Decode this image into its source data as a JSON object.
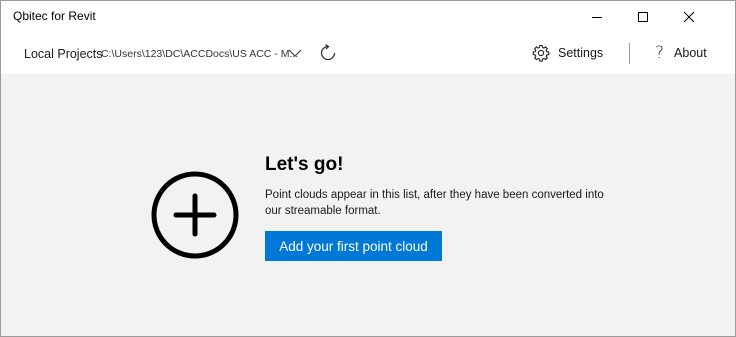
{
  "window": {
    "title": "Qbitec for Revit"
  },
  "toolbar": {
    "project_label": "Local Projects",
    "project_path": "C:\\Users\\123\\DC\\ACCDocs\\US ACC - M...",
    "settings_label": "Settings",
    "about_label": "About",
    "about_glyph": "?"
  },
  "empty_state": {
    "heading": "Let's go!",
    "description": "Point clouds appear in this list, after they have been converted into our streamable format.",
    "cta_label": "Add your first point cloud"
  },
  "colors": {
    "accent": "#0078d7",
    "content_bg": "#f2f2f2"
  },
  "icons": {
    "minimize": "minimize-icon",
    "maximize": "maximize-icon",
    "close": "close-icon",
    "dropdown": "chevron-down-icon",
    "refresh": "refresh-icon",
    "settings": "gear-icon",
    "about": "question-mark-icon",
    "add": "plus-circle-icon"
  }
}
